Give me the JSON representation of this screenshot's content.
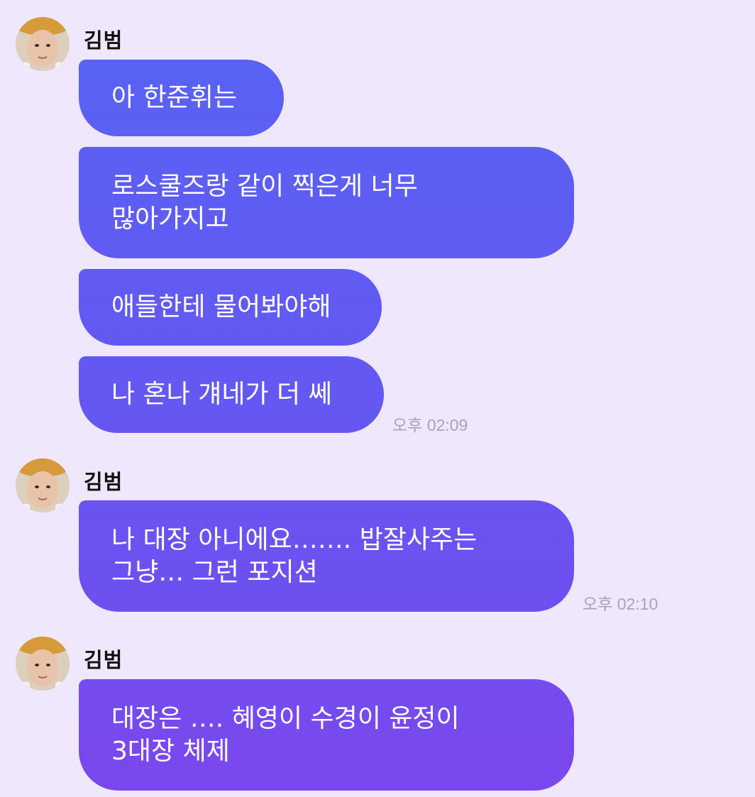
{
  "colors": {
    "background": "#efe7fb",
    "bubble_gradient_start": "#5862f4",
    "bubble_gradient_end": "#7a47ee",
    "timestamp": "#a8a3b6"
  },
  "messages": [
    {
      "sender": "김범",
      "bubbles": [
        "아 한준휘는",
        "로스쿨즈랑 같이 찍은게 너무\n많아가지고",
        "애들한테 물어봐야해",
        "나 혼나 걔네가 더 쎄"
      ],
      "time": "오후 02:09"
    },
    {
      "sender": "김범",
      "bubbles": [
        "나 대장 아니에요……. 밥잘사주는\n그냥… 그런 포지션"
      ],
      "time": "오후 02:10"
    },
    {
      "sender": "김범",
      "bubbles": [
        "대장은 …. 혜영이 수경이 윤정이\n3대장 체제"
      ],
      "time": ""
    }
  ]
}
